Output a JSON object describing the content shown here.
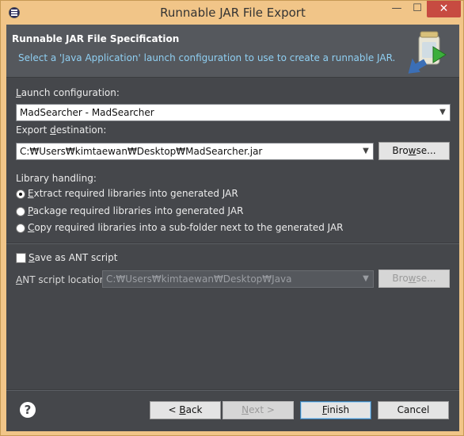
{
  "window": {
    "title": "Runnable JAR File Export",
    "minimize_glyph": "—",
    "maximize_glyph": "☐",
    "close_glyph": "✕"
  },
  "header": {
    "title": "Runnable JAR File Specification",
    "description": "Select a 'Java Application' launch configuration to use to create a runnable JAR."
  },
  "launch": {
    "label_mnemonic": "L",
    "label_rest": "aunch configuration:",
    "value": "MadSearcher - MadSearcher"
  },
  "export": {
    "label_pre": "Export ",
    "label_mnemonic": "d",
    "label_post": "estination:",
    "value": "C:₩Users₩kimtaewan₩Desktop₩MadSearcher.jar",
    "browse_mnemonic": "w",
    "browse_pre": "Bro",
    "browse_post": "se..."
  },
  "library": {
    "label": "Library handling:",
    "options": [
      {
        "mnemonic": "E",
        "rest": "xtract required libraries into generated JAR",
        "checked": true
      },
      {
        "mnemonic": "P",
        "rest": "ackage required libraries into generated JAR",
        "checked": false
      },
      {
        "mnemonic": "C",
        "rest": "opy required libraries into a sub-folder next to the generated JAR",
        "checked": false
      }
    ]
  },
  "ant": {
    "checkbox_mnemonic": "S",
    "checkbox_rest": "ave as ANT script",
    "checked": false,
    "location_mnemonic": "A",
    "location_rest": "NT script location:",
    "location_value": "C:₩Users₩kimtaewan₩Desktop₩Java",
    "browse_pre": "Bro",
    "browse_mnemonic": "w",
    "browse_post": "se..."
  },
  "footer": {
    "help_glyph": "?",
    "back_pre": "< ",
    "back_mnemonic": "B",
    "back_post": "ack",
    "next_mnemonic": "N",
    "next_post": "ext >",
    "finish_mnemonic": "F",
    "finish_post": "inish",
    "cancel_label": "Cancel"
  }
}
